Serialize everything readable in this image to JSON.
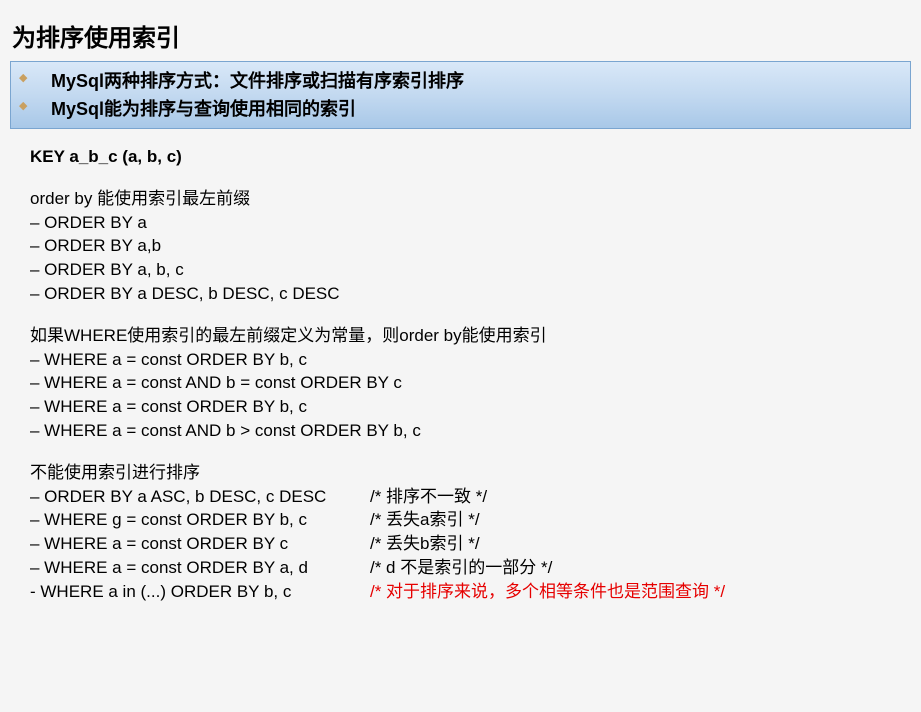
{
  "title": "为排序使用索引",
  "bullets": [
    "MySql两种排序方式：文件排序或扫描有序索引排序",
    "MySql能为排序与查询使用相同的索引"
  ],
  "keyLine": "KEY a_b_c (a, b, c)",
  "section1": {
    "head": "order by 能使用索引最左前缀",
    "lines": [
      "– ORDER BY a",
      "– ORDER BY a,b",
      "– ORDER BY a, b, c",
      "– ORDER BY a DESC, b DESC, c DESC"
    ]
  },
  "section2": {
    "head": "如果WHERE使用索引的最左前缀定义为常量，则order by能使用索引",
    "lines": [
      "– WHERE a = const ORDER BY b, c",
      "– WHERE a = const AND b = const ORDER BY c",
      "– WHERE a = const ORDER BY b, c",
      "– WHERE a = const AND b > const ORDER BY b, c"
    ]
  },
  "section3": {
    "head": "不能使用索引进行排序",
    "rows": [
      {
        "left": "– ORDER BY a ASC, b DESC, c DESC",
        "comment": "/* 排序不一致 */",
        "red": false
      },
      {
        "left": "– WHERE g = const ORDER BY b, c",
        "comment": "/* 丢失a索引 */",
        "red": false
      },
      {
        "left": "– WHERE a = const ORDER BY c",
        "comment": "/* 丢失b索引 */",
        "red": false
      },
      {
        "left": "– WHERE a = const ORDER BY a, d",
        "comment": "/* d 不是索引的一部分 */",
        "red": false
      },
      {
        "left": "- WHERE a in (...) ORDER BY b, c",
        "comment": "/* 对于排序来说，多个相等条件也是范围查询 */",
        "red": true
      }
    ]
  }
}
